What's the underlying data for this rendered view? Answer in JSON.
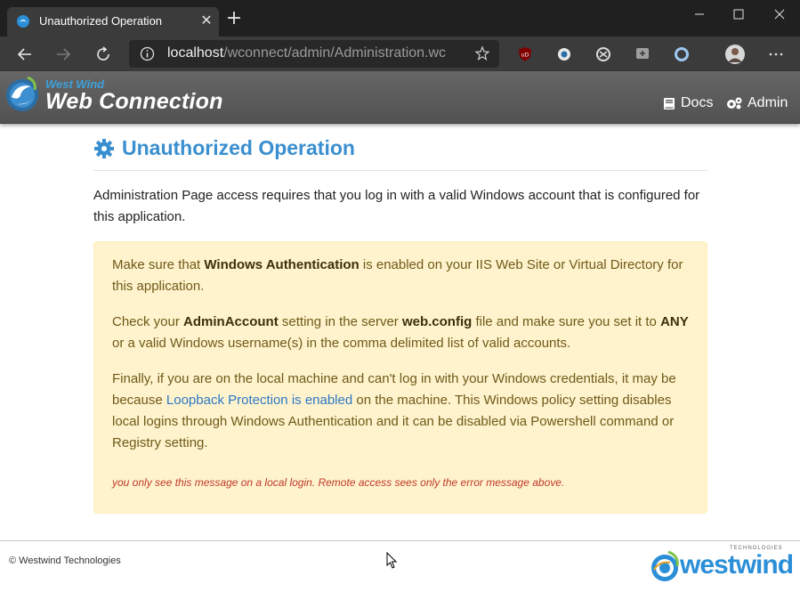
{
  "browser": {
    "tab_title": "Unauthorized Operation",
    "url_host": "localhost",
    "url_path": "/wconnect/admin/Administration.wc"
  },
  "site_header": {
    "logo_small": "West Wind",
    "logo_big": "Web Connection",
    "nav": [
      {
        "label": "Docs",
        "icon": "book-icon"
      },
      {
        "label": "Admin",
        "icon": "gears-icon"
      }
    ]
  },
  "main": {
    "title": "Unauthorized Operation",
    "intro": "Administration Page access requires that you log in with a valid Windows account that is configured for this application.",
    "alert": {
      "p1": {
        "pre": "Make sure that ",
        "bold": "Windows Authentication",
        "post": " is enabled on your IIS Web Site or Virtual Directory for this application."
      },
      "p2": {
        "pre": "Check your ",
        "bold1": "AdminAccount",
        "mid1": " setting in the server ",
        "bold2": "web.config",
        "mid2": " file and make sure you set it to ",
        "bold3": "ANY",
        "post": " or a valid Windows username(s) in the comma delimited list of valid accounts."
      },
      "p3": {
        "pre": "Finally, if you are on the local machine and can't log in with your Windows credentials, it may be because ",
        "link": "Loopback Protection is enabled",
        "post": " on the machine. This Windows policy setting disables local logins through Windows Authentication and it can be disabled via Powershell command or Registry setting."
      },
      "note": "you only see this message on a local login. Remote access sees only the error message above."
    }
  },
  "footer": {
    "copyright": "© Westwind Technologies",
    "logo_word": "westwind",
    "logo_tech": "TECHNOLOGIES"
  },
  "colors": {
    "accent": "#3a8fd0",
    "alert_bg": "#fff3cd",
    "note": "#c0392b"
  }
}
